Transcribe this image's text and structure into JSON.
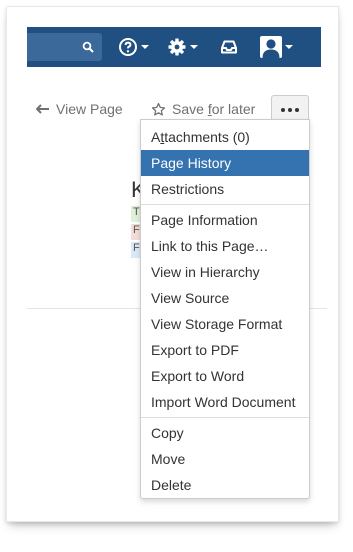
{
  "header": {
    "help_icon": "question-circle-icon",
    "settings_icon": "gear-icon",
    "notifications_icon": "inbox-tray-icon",
    "user_icon": "user-avatar-icon",
    "bar_color": "#205081"
  },
  "page_actions": {
    "view_page_label": "View Page",
    "save_for_later": {
      "before": "Save ",
      "underlined": "f",
      "after": "or later"
    },
    "more_icon": "ellipsis-icon"
  },
  "background_content": {
    "title_fragment": "K",
    "lozenges": [
      "T",
      "F",
      "F"
    ]
  },
  "menu": {
    "group1": [
      {
        "parts": [
          "A",
          "t",
          "tachments (0)"
        ],
        "active": false
      },
      {
        "label": "Page History",
        "active": true
      },
      {
        "label": "Restrictions",
        "active": false
      }
    ],
    "group2": [
      "Page Information",
      "Link to this Page…",
      "View in Hierarchy",
      "View Source",
      "View Storage Format",
      "Export to PDF",
      "Export to Word",
      "Import Word Document"
    ],
    "group3": [
      "Copy",
      "Move",
      "Delete"
    ],
    "active_color": "#3572b0"
  }
}
